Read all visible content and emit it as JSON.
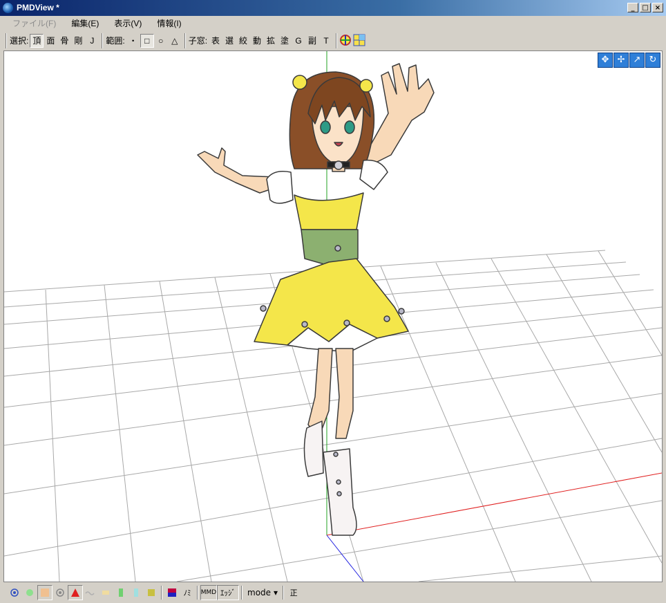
{
  "window": {
    "title": "PMDView *",
    "min": "_",
    "max": "□",
    "close": "×"
  },
  "menu": [
    {
      "label": "ファイル(F)",
      "disabled": true
    },
    {
      "label": "編集(E)"
    },
    {
      "label": "表示(V)"
    },
    {
      "label": "情報(I)"
    }
  ],
  "toolbar": {
    "select_label": "選択:",
    "select_buttons": [
      "頂",
      "面",
      "骨",
      "剛",
      "J"
    ],
    "range_label": "範囲:",
    "range_buttons": [
      "・",
      "□",
      "○",
      "△"
    ],
    "child_label": "子窓:",
    "child_buttons": [
      "表",
      "選",
      "絞",
      "動",
      "拡",
      "塗",
      "G",
      "副",
      "T"
    ]
  },
  "viewport_controls": [
    "✥",
    "✢",
    "↗",
    "↻"
  ],
  "status": {
    "mode_label": "mode",
    "edge_label": "ｴｯｼﾞ",
    "nomi_label": "ﾉﾐ",
    "mmd_label": "MMD",
    "fix_label": "正"
  },
  "colors": {
    "accent": "#0a246a",
    "grid": "#a0a0a0",
    "x_axis": "#e02020",
    "y_axis": "#20a020",
    "z_axis": "#2020e0",
    "dress": "#f4e64a",
    "corset": "#8cb070"
  }
}
